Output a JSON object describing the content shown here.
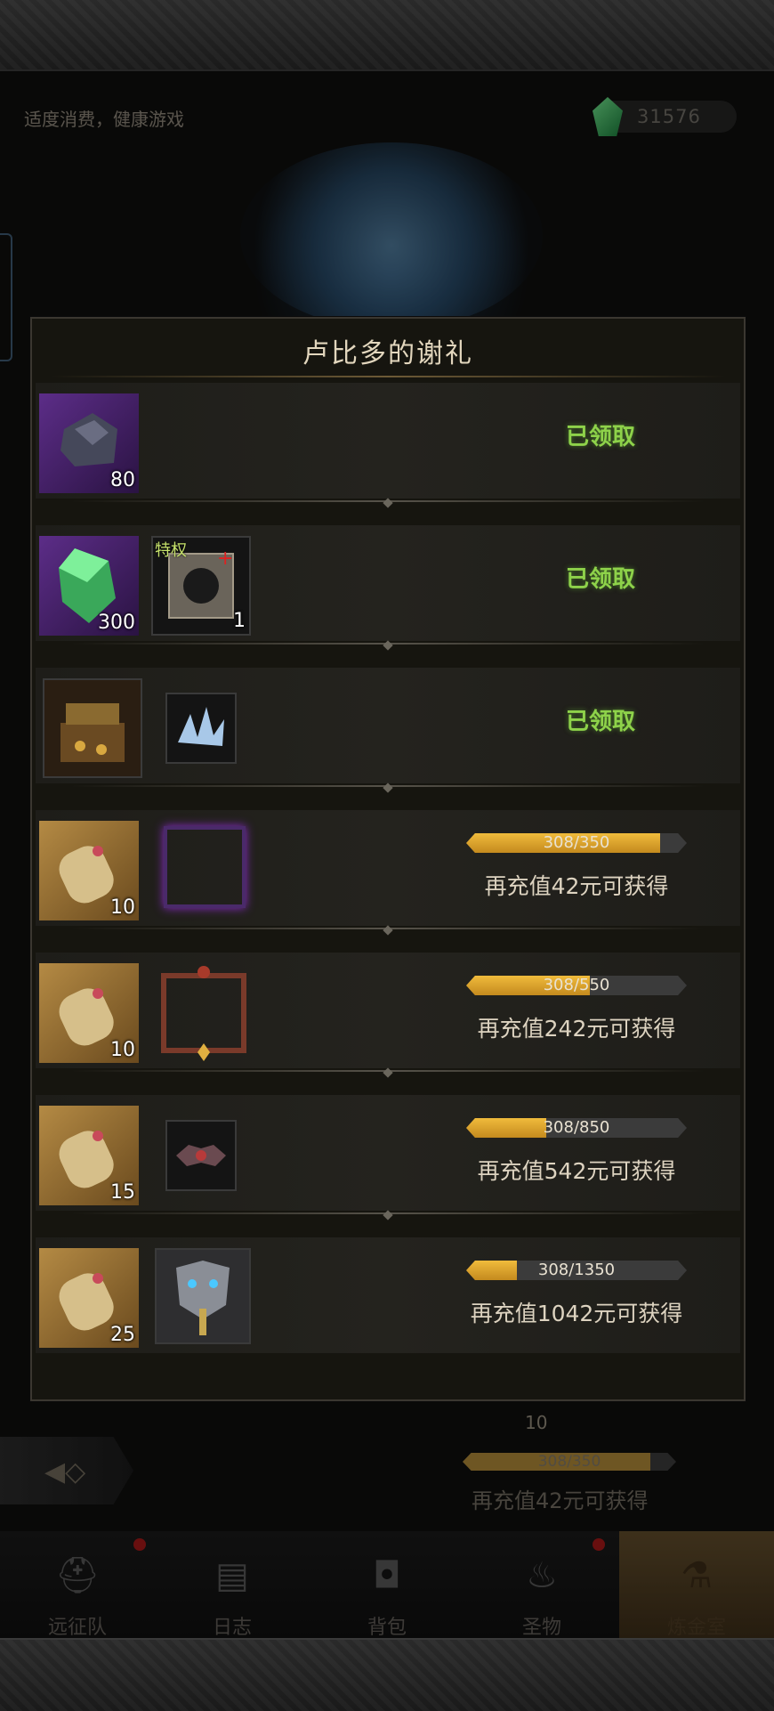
{
  "header": {
    "health_tip": "适度消费，健康游戏",
    "currency_amount": "31576",
    "currency_icon": "green-gem-icon"
  },
  "modal": {
    "title": "卢比多的谢礼",
    "rows": [
      {
        "items": [
          {
            "icon": "ore-icon",
            "count": "80"
          }
        ],
        "status": "已领取"
      },
      {
        "items": [
          {
            "icon": "green-crystal-icon",
            "count": "300"
          },
          {
            "icon": "privilege-card-icon",
            "count": "1",
            "tag": "特权"
          }
        ],
        "status": "已领取"
      },
      {
        "items": [
          {
            "icon": "treasure-chest-icon"
          },
          {
            "icon": "ice-crystal-icon"
          }
        ],
        "status": "已领取"
      },
      {
        "items": [
          {
            "icon": "scroll-icon",
            "count": "10"
          },
          {
            "icon": "purple-frame-icon"
          }
        ],
        "progress": {
          "current": 308,
          "total": 350,
          "label": "308/350"
        },
        "hint": "再充值42元可获得"
      },
      {
        "items": [
          {
            "icon": "scroll-icon",
            "count": "10"
          },
          {
            "icon": "ornate-frame-icon"
          }
        ],
        "progress": {
          "current": 308,
          "total": 550,
          "label": "308/550"
        },
        "hint": "再充值242元可获得"
      },
      {
        "items": [
          {
            "icon": "scroll-icon",
            "count": "15"
          },
          {
            "icon": "demon-emblem-icon"
          }
        ],
        "progress": {
          "current": 308,
          "total": 850,
          "label": "308/850"
        },
        "hint": "再充值542元可获得"
      },
      {
        "items": [
          {
            "icon": "scroll-icon",
            "count": "25"
          },
          {
            "icon": "silver-mask-icon"
          }
        ],
        "progress": {
          "current": 308,
          "total": 1350,
          "label": "308/1350"
        },
        "hint": "再充值1042元可获得"
      }
    ]
  },
  "behind": {
    "count": "10",
    "progress": {
      "current": 308,
      "total": 350,
      "label": "308/350"
    },
    "hint": "再充值42元可获得"
  },
  "nav": {
    "items": [
      {
        "label": "远征队",
        "icon": "viking-helmet-icon"
      },
      {
        "label": "日志",
        "icon": "map-icon"
      },
      {
        "label": "背包",
        "icon": "backpack-icon"
      },
      {
        "label": "圣物",
        "icon": "torch-icon"
      },
      {
        "label": "炼金室",
        "icon": "alchemy-icon"
      }
    ]
  },
  "colors": {
    "claimed": "#8ed24a",
    "progress_fill": "#e0a42c",
    "accent_gold": "#c48a1e"
  }
}
